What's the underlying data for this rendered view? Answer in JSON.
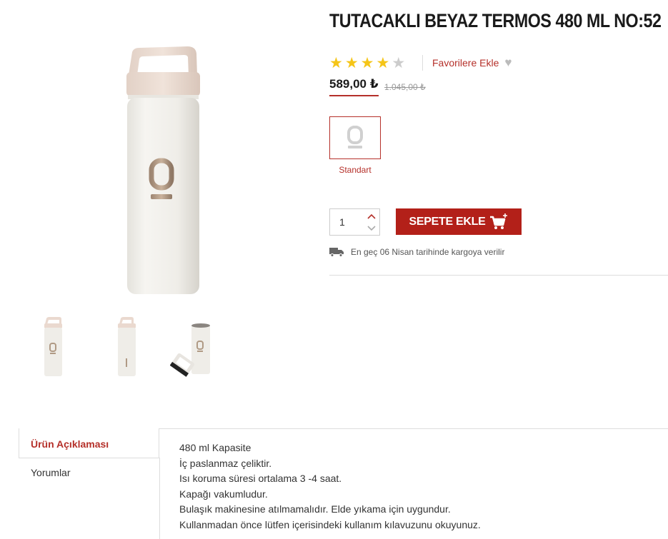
{
  "product": {
    "title": "TUTACAKLI BEYAZ TERMOS 480 ML NO:52",
    "rating": 4,
    "rating_max": 5,
    "favorite_label": "Favorilere Ekle",
    "price": "589,00 ₺",
    "old_price": "1.045,00 ₺",
    "variant": {
      "label": "Standart"
    },
    "quantity": "1",
    "add_to_cart_label": "SEPETE EKLE",
    "shipping_text": "En geç 06 Nisan tarihinde kargoya verilir"
  },
  "colors": {
    "accent": "#b5302a",
    "button": "#b32019",
    "star_on": "#f5c518",
    "star_off": "#cccccc"
  },
  "tabs": {
    "description_label": "Ürün Açıklaması",
    "reviews_label": "Yorumlar"
  },
  "description": [
    "480 ml Kapasite",
    "İç paslanmaz çeliktir.",
    "Isı koruma süresi ortalama 3 -4 saat.",
    "Kapağı vakumludur.",
    "Bulaşık makinesine atılmamalıdır. Elde yıkama için uygundur.",
    "Kullanmadan önce lütfen içerisindeki kullanım kılavuzunu okuyunuz."
  ]
}
